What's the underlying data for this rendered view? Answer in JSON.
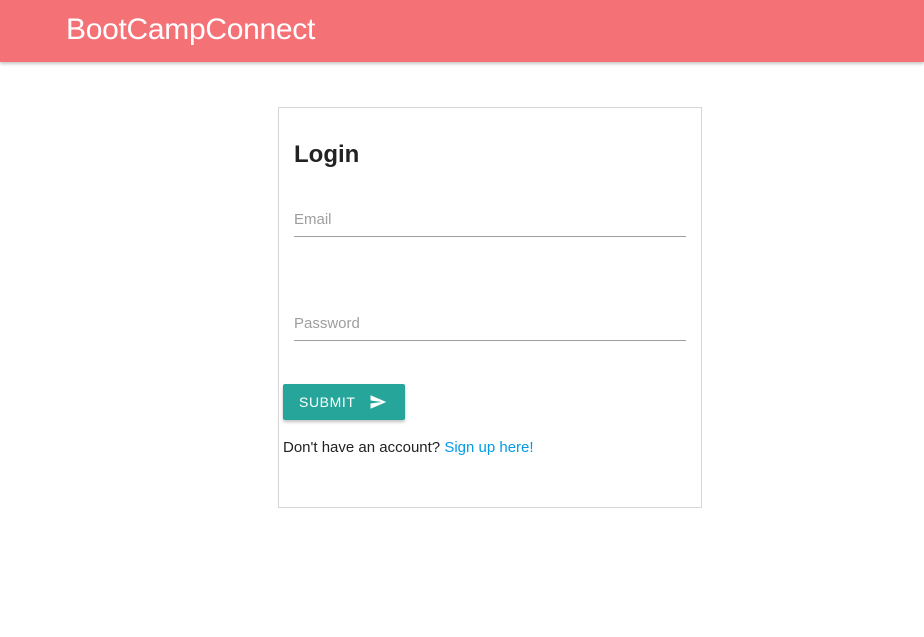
{
  "navbar": {
    "brand": "BootCampConnect",
    "background_color": "#f47176"
  },
  "login": {
    "title": "Login",
    "email_label": "Email",
    "email_value": "",
    "password_label": "Password",
    "password_value": "",
    "submit_label": "SUBMIT",
    "submit_icon": "send-icon",
    "submit_color": "#26a69a",
    "signup_prompt": "Don't have an account?",
    "signup_link": "Sign up here!",
    "link_color": "#039be5"
  }
}
